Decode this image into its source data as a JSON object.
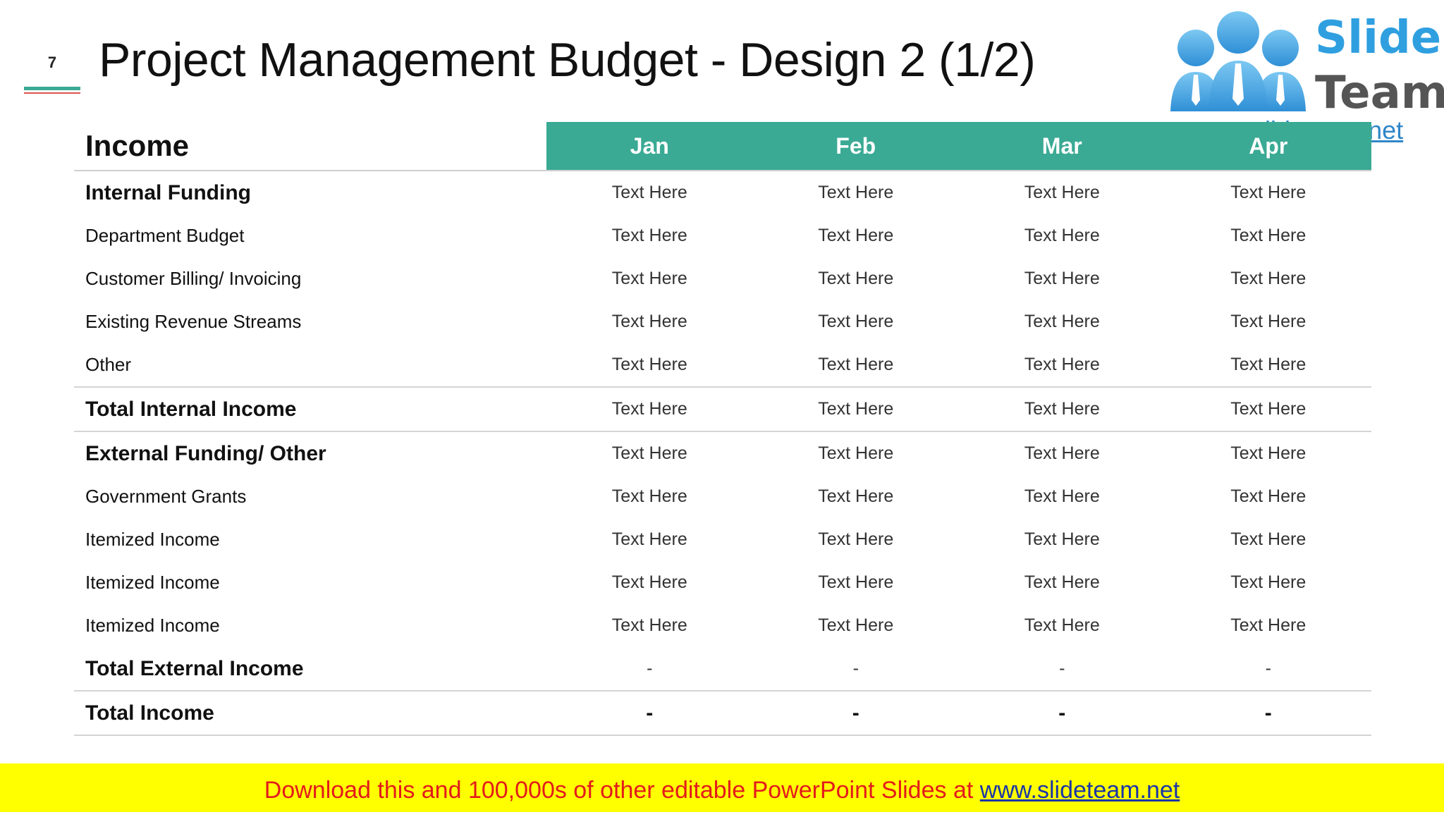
{
  "slide": {
    "number": "7",
    "title": "Project Management Budget - Design 2 (1/2)"
  },
  "logo": {
    "word1": "Slide",
    "word2": "Team",
    "url": "www.slideteam.net",
    "colors": {
      "blue": "#2f9fe0",
      "gray": "#555555"
    }
  },
  "table": {
    "header_label": "Income",
    "months": [
      "Jan",
      "Feb",
      "Mar",
      "Apr"
    ],
    "header_color": "#3aaa94",
    "rows": [
      {
        "label": "Internal Funding",
        "bold": true,
        "values": [
          "Text Here",
          "Text Here",
          "Text Here",
          "Text Here"
        ]
      },
      {
        "label": "Department Budget",
        "bold": false,
        "values": [
          "Text Here",
          "Text Here",
          "Text Here",
          "Text Here"
        ]
      },
      {
        "label": "Customer Billing/ Invoicing",
        "bold": false,
        "values": [
          "Text Here",
          "Text Here",
          "Text Here",
          "Text Here"
        ]
      },
      {
        "label": "Existing Revenue Streams",
        "bold": false,
        "values": [
          "Text Here",
          "Text Here",
          "Text Here",
          "Text Here"
        ]
      },
      {
        "label": "Other",
        "bold": false,
        "values": [
          "Text Here",
          "Text Here",
          "Text Here",
          "Text Here"
        ]
      },
      {
        "label": "Total Internal Income",
        "bold": true,
        "values": [
          "Text Here",
          "Text Here",
          "Text Here",
          "Text Here"
        ]
      },
      {
        "label": "External Funding/ Other",
        "bold": true,
        "values": [
          "Text Here",
          "Text Here",
          "Text Here",
          "Text Here"
        ]
      },
      {
        "label": "Government Grants",
        "bold": false,
        "values": [
          "Text Here",
          "Text Here",
          "Text Here",
          "Text Here"
        ]
      },
      {
        "label": "Itemized Income",
        "bold": false,
        "values": [
          "Text Here",
          "Text Here",
          "Text Here",
          "Text Here"
        ]
      },
      {
        "label": "Itemized Income",
        "bold": false,
        "values": [
          "Text Here",
          "Text Here",
          "Text Here",
          "Text Here"
        ]
      },
      {
        "label": "Itemized Income",
        "bold": false,
        "values": [
          "Text Here",
          "Text Here",
          "Text Here",
          "Text Here"
        ]
      },
      {
        "label": "Total External Income",
        "bold": true,
        "values": [
          "-",
          "-",
          "-",
          "-"
        ]
      },
      {
        "label": "Total Income",
        "bold": true,
        "values": [
          "-",
          "-",
          "-",
          "-"
        ]
      }
    ]
  },
  "footer": {
    "text": "Download this and 100,000s of other editable PowerPoint Slides at ",
    "link": "www.slideteam.net",
    "background": "#ffff00",
    "text_color": "#e31b1b"
  }
}
